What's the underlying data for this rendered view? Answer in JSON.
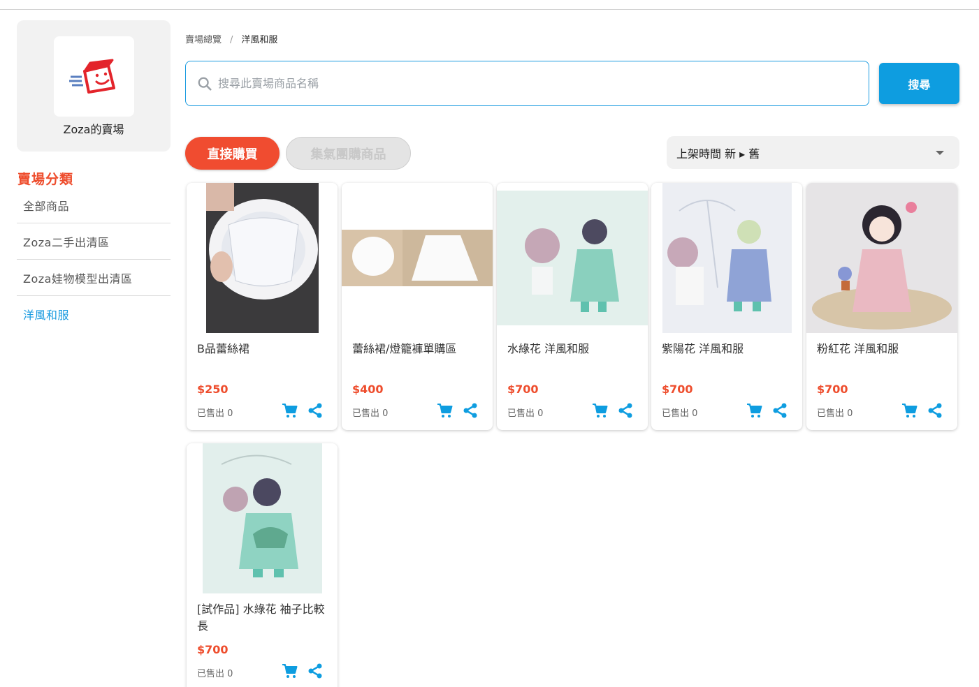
{
  "shop": {
    "name": "Zoza的賣場"
  },
  "sidebar": {
    "title": "賣場分類",
    "items": [
      {
        "label": "全部商品"
      },
      {
        "label": "Zoza二手出清區"
      },
      {
        "label": "Zoza娃物模型出清區"
      },
      {
        "label": "洋風和服",
        "active": true
      }
    ]
  },
  "breadcrumb": {
    "root": "賣場總覽",
    "separator": "/",
    "current": "洋風和服"
  },
  "search": {
    "placeholder": "搜尋此賣場商品名稱",
    "value": "",
    "button": "搜尋"
  },
  "filters": {
    "direct": "直接購買",
    "group": "集氣團購商品"
  },
  "sort": {
    "selected": "上架時間 新 ▸ 舊"
  },
  "colors": {
    "accent_blue": "#0e9de0",
    "accent_red": "#ee4d2d"
  },
  "products": [
    {
      "name": "B品蕾絲裙",
      "price": "$250",
      "sold": "已售出 0"
    },
    {
      "name": "蕾絲裙/燈籠褲單購區",
      "price": "$400",
      "sold": "已售出 0"
    },
    {
      "name": "水綠花 洋風和服",
      "price": "$700",
      "sold": "已售出 0"
    },
    {
      "name": "紫陽花 洋風和服",
      "price": "$700",
      "sold": "已售出 0"
    },
    {
      "name": "粉紅花 洋風和服",
      "price": "$700",
      "sold": "已售出 0"
    },
    {
      "name": "[試作品] 水綠花 袖子比較長",
      "price": "$700",
      "sold": "已售出 0"
    }
  ]
}
